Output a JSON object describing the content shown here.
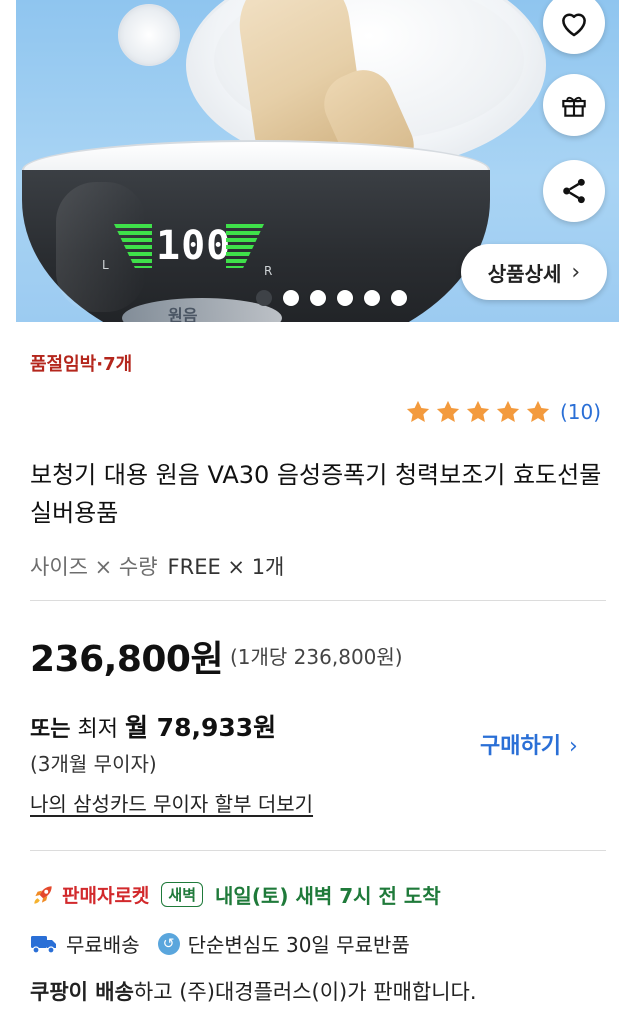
{
  "hero": {
    "display_digits": "100",
    "display_left": "L",
    "display_right": "R",
    "brand_mark": "원음",
    "detail_button": "상품상세",
    "slide_count": 6,
    "active_slide": 1
  },
  "product": {
    "stock_notice": "품절임박·7개",
    "rating": 5,
    "review_count": "(10)",
    "title": "보청기 대용 원음 VA30 음성증폭기 청력보조기 효도선물 실버용품",
    "option_label": "사이즈 × 수량",
    "option_value": "FREE × 1개"
  },
  "price": {
    "total": "236,800원",
    "unit": "(1개당 236,800원)",
    "monthly_prefix": "또는",
    "monthly_mid": "최저",
    "monthly_amount": "월 78,933원",
    "interest_free": "(3개월 무이자)",
    "card_link": "나의 삼성카드 무이자 할부 더보기",
    "buy_label": "구매하기"
  },
  "delivery": {
    "seller_rocket": "판매자로켓",
    "dawn_badge": "새벽",
    "arrival": "내일(토) 새벽 7시 전 도착",
    "free_shipping": "무료배송",
    "free_return": "단순변심도 30일 무료반품",
    "seller_bold": "쿠팡이 배송",
    "seller_rest": "하고 (주)대경플러스(이)가 판매합니다."
  },
  "colors": {
    "accent_blue": "#2a6fd6",
    "stock_red": "#b4261c",
    "star_orange": "#f39a3d",
    "dawn_green": "#1f7a3a"
  },
  "icons": [
    "heart-icon",
    "gift-icon",
    "share-icon",
    "chevron-right-icon",
    "star-icon",
    "rocket-icon",
    "truck-icon",
    "return-icon"
  ]
}
